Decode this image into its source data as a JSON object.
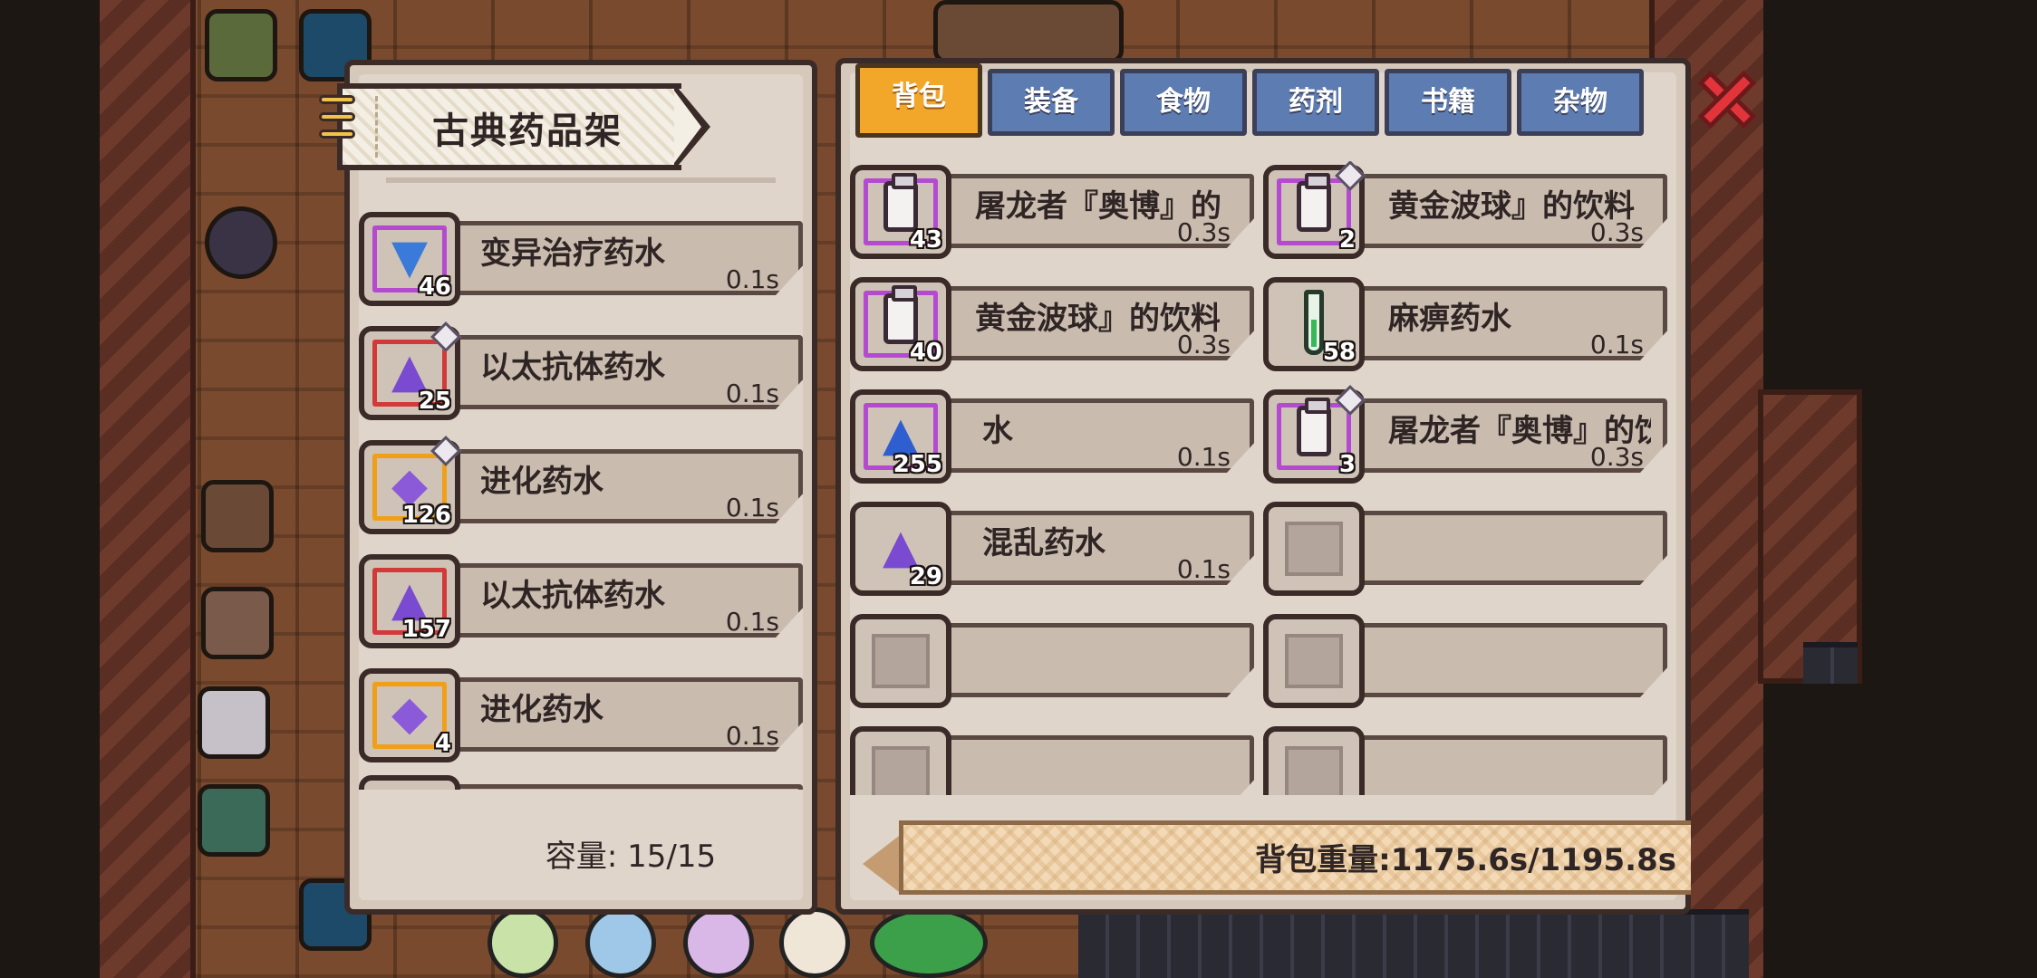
{
  "shelf": {
    "title": "古典药品架",
    "capacity": "容量: 15/15",
    "items": [
      {
        "name": "变异治疗药水",
        "weight": "0.1s",
        "count": "46",
        "icon": "blue-potion-icon",
        "frame": "purple",
        "gem": false
      },
      {
        "name": "以太抗体药水",
        "weight": "0.1s",
        "count": "25",
        "icon": "purple-flask-icon",
        "frame": "red",
        "gem": true
      },
      {
        "name": "进化药水",
        "weight": "0.1s",
        "count": "126",
        "icon": "purple-vial-icon",
        "frame": "orange",
        "gem": true
      },
      {
        "name": "以太抗体药水",
        "weight": "0.1s",
        "count": "157",
        "icon": "purple-flask-icon",
        "frame": "red",
        "gem": false
      },
      {
        "name": "进化药水",
        "weight": "0.1s",
        "count": "4",
        "icon": "purple-vial-icon",
        "frame": "orange",
        "gem": false
      }
    ]
  },
  "tabs": [
    {
      "label": "背包",
      "active": true
    },
    {
      "label": "装备",
      "active": false
    },
    {
      "label": "食物",
      "active": false
    },
    {
      "label": "药剂",
      "active": false
    },
    {
      "label": "书籍",
      "active": false
    },
    {
      "label": "杂物",
      "active": false
    }
  ],
  "bag": {
    "items": [
      {
        "name": "屠龙者『奥博』的饮",
        "weight": "0.3s",
        "count": "43",
        "icon": "milk-jar-icon",
        "frame": "purple",
        "gem": false
      },
      {
        "name": "黄金波球』的饮料",
        "weight": "0.3s",
        "count": "2",
        "icon": "milk-jar-icon",
        "frame": "purple",
        "gem": true
      },
      {
        "name": "黄金波球』的饮料",
        "weight": "0.3s",
        "count": "40",
        "icon": "milk-jar-icon",
        "frame": "purple",
        "gem": false
      },
      {
        "name": "麻痹药水",
        "weight": "0.1s",
        "count": "58",
        "icon": "green-tube-icon",
        "frame": "none",
        "gem": false
      },
      {
        "name": "水",
        "weight": "0.1s",
        "count": "255",
        "icon": "water-flask-icon",
        "frame": "purple",
        "gem": false
      },
      {
        "name": "屠龙者『奥博』的饮",
        "weight": "0.3s",
        "count": "3",
        "icon": "milk-jar-icon",
        "frame": "purple",
        "gem": true
      },
      {
        "name": "混乱药水",
        "weight": "0.1s",
        "count": "29",
        "icon": "purple-flask-icon",
        "frame": "none",
        "gem": false
      }
    ],
    "weight_label": "背包重量:1175.6s/1195.8s"
  },
  "close_icon": "close-x-icon"
}
